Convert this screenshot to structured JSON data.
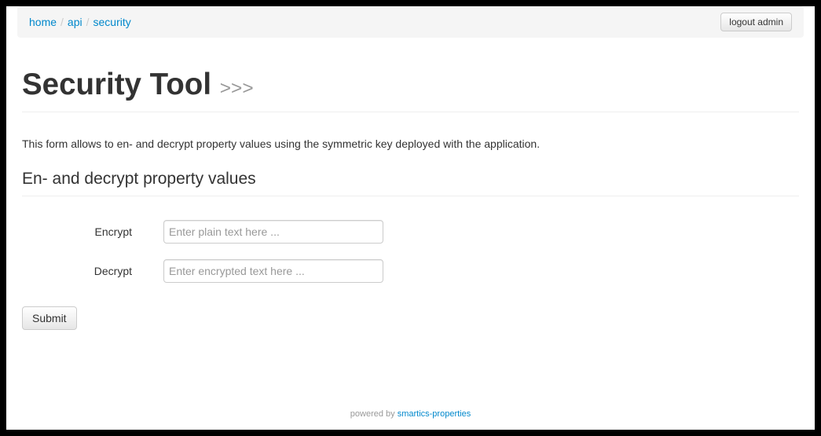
{
  "breadcrumb": {
    "items": [
      {
        "label": "home"
      },
      {
        "label": "api"
      },
      {
        "label": "security"
      }
    ],
    "divider": "/"
  },
  "header": {
    "logout_label": "logout admin"
  },
  "page": {
    "title": "Security Tool",
    "title_suffix": ">>>",
    "description": "This form allows to en- and decrypt property values using the symmetric key deployed with the application.",
    "subheading": "En- and decrypt property values"
  },
  "form": {
    "encrypt": {
      "label": "Encrypt",
      "placeholder": "Enter plain text here ...",
      "value": ""
    },
    "decrypt": {
      "label": "Decrypt",
      "placeholder": "Enter encrypted text here ...",
      "value": ""
    },
    "submit_label": "Submit"
  },
  "footer": {
    "prefix": "powered by ",
    "link_label": "smartics-properties"
  }
}
